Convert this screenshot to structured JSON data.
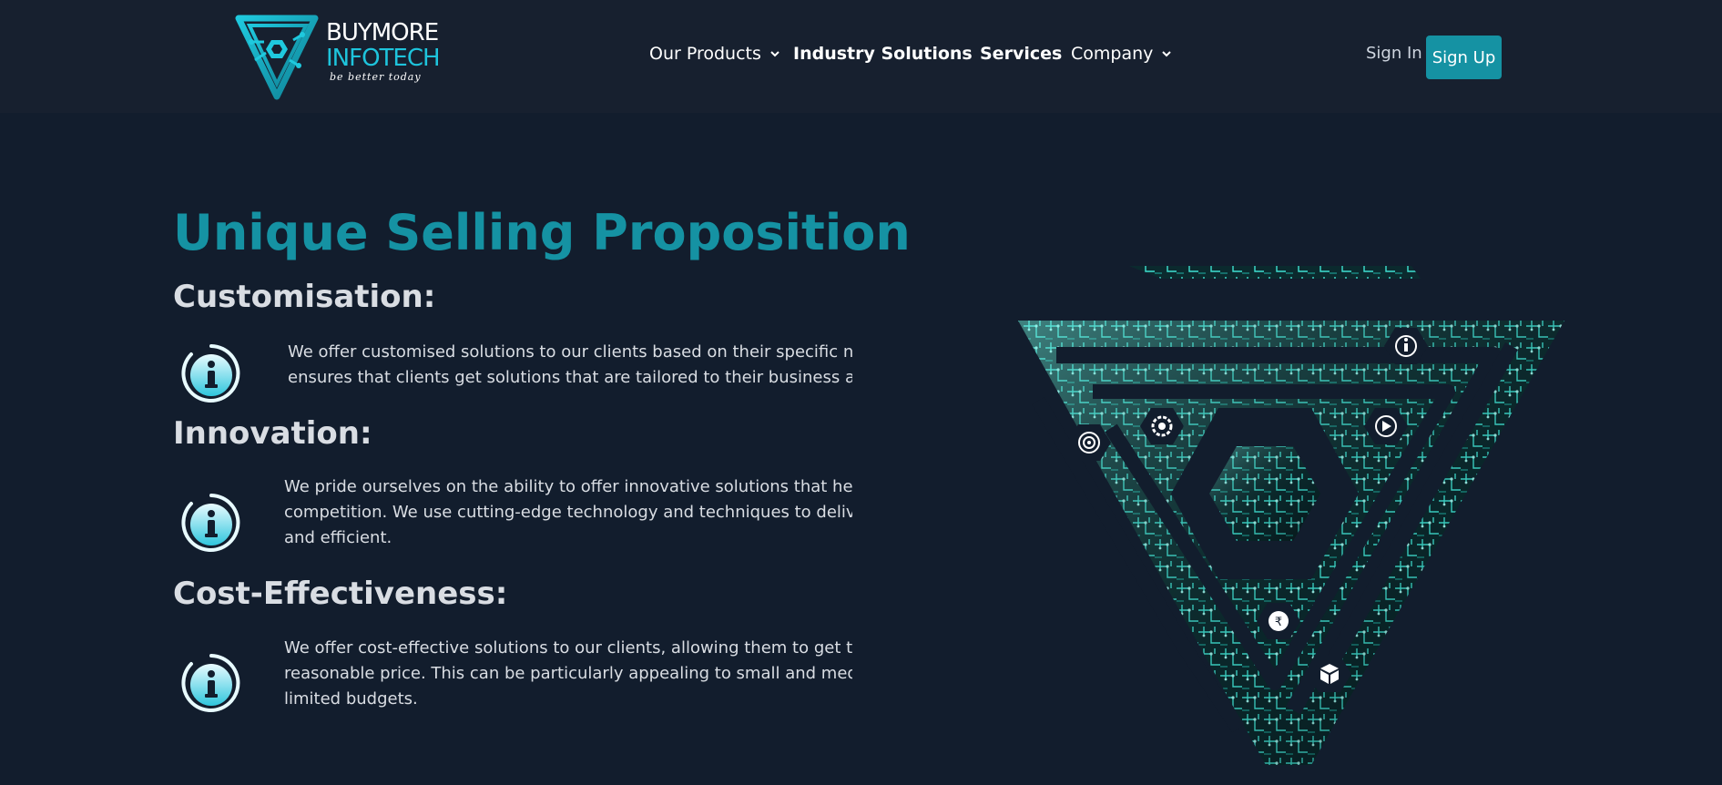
{
  "brand": {
    "line1": "BUYMORE",
    "line2": "INFOTECH",
    "tagline": "be better today"
  },
  "nav": {
    "items": [
      {
        "label": "Our Products",
        "dropdown": true
      },
      {
        "label": "Industry Solutions",
        "dropdown": false
      },
      {
        "label": "Services",
        "dropdown": false
      },
      {
        "label": "Company",
        "dropdown": true
      }
    ],
    "sign_in": "Sign In",
    "sign_up": "Sign Up"
  },
  "main": {
    "title": "Unique Selling Proposition",
    "features": [
      {
        "heading": "Customisation:",
        "icon": "info-icon",
        "lines": [
          "We offer customised solutions to our clients based on their specific needs",
          "ensures that clients get solutions that are tailored to their business and t"
        ]
      },
      {
        "heading": "Innovation:",
        "icon": "info-icon",
        "lines": [
          "We pride ourselves on the ability to offer innovative solutions that help c",
          "competition. We use cutting-edge technology and techniques to deliver s",
          "and efficient."
        ]
      },
      {
        "heading": "Cost-Effectiveness:",
        "icon": "info-icon",
        "lines": [
          "We offer cost-effective solutions to our clients, allowing them to get the s",
          "reasonable price. This can be particularly appealing to small and medium",
          "limited budgets."
        ]
      }
    ]
  },
  "hero_icons": [
    "info-icon",
    "play-icon",
    "gear-icon",
    "target-icon",
    "rupee-icon",
    "box-icon"
  ],
  "colors": {
    "background": "#121d2d",
    "header": "#17202f",
    "accent": "#1592a3",
    "brand_cyan": "#1ec4dc"
  }
}
